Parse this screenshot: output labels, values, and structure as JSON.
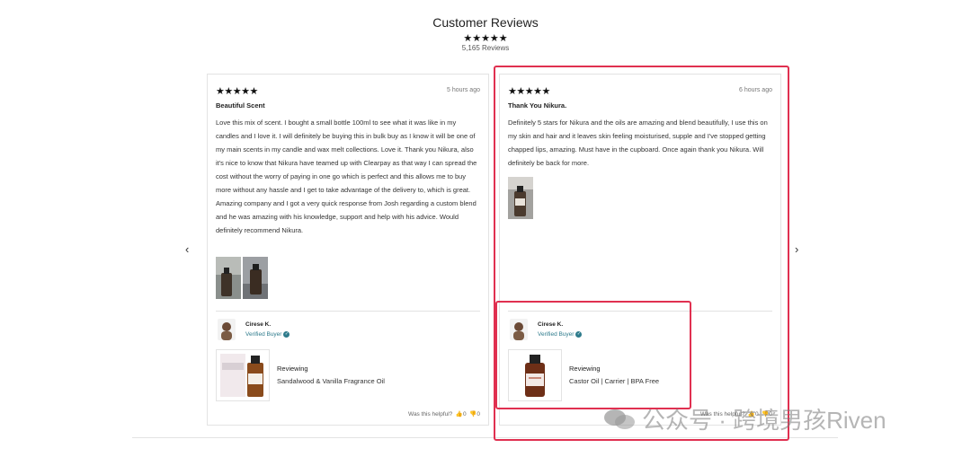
{
  "header": {
    "title": "Customer Reviews",
    "stars": "★★★★★",
    "count": "5,165 Reviews"
  },
  "nav": {
    "prev": "‹",
    "next": "›"
  },
  "reviews": [
    {
      "stars": "★★★★★",
      "time": "5 hours ago",
      "title": "Beautiful Scent",
      "body": "Love this mix of scent. I bought a small bottle 100ml to see what it was like in my candles and I love it. I will definitely be buying this in bulk buy as I know it will be one of my main scents in my candle and wax melt collections. Love it. Thank you Nikura, also it's nice to know that Nikura have teamed up with Clearpay as that way I can spread the cost without the worry of paying in one go which is perfect and this allows me to buy more without any hassle and I get to take advantage of the delivery to, which is great. Amazing company and I got a very quick response from Josh regarding a custom blend and he was amazing with his knowledge, support and help with his advice. Would definitely recommend Nikura.",
      "user": "Cirese K.",
      "verified": "Verified Buyer",
      "reviewing_label": "Reviewing",
      "product": "Sandalwood & Vanilla Fragrance Oil",
      "helpful_label": "Was this helpful?",
      "up_count": "0",
      "down_count": "0"
    },
    {
      "stars": "★★★★★",
      "time": "6 hours ago",
      "title": "Thank You Nikura.",
      "body": "Definitely 5 stars for Nikura and the oils are amazing and blend beautifully, I use this on my skin and hair and it leaves skin feeling moisturised, supple and I've stopped getting chapped lips, amazing. Must have in the cupboard. Once again thank you Nikura. Will definitely be back for more.",
      "user": "Cirese K.",
      "verified": "Verified Buyer",
      "reviewing_label": "Reviewing",
      "product": "Castor Oil | Carrier | BPA Free",
      "helpful_label": "Was this helpful?",
      "up_count": "0",
      "down_count": "0"
    }
  ],
  "watermark": "公众号 · 跨境男孩Riven",
  "colors": {
    "highlight": "#e03050",
    "verified": "#2e7b8c"
  }
}
